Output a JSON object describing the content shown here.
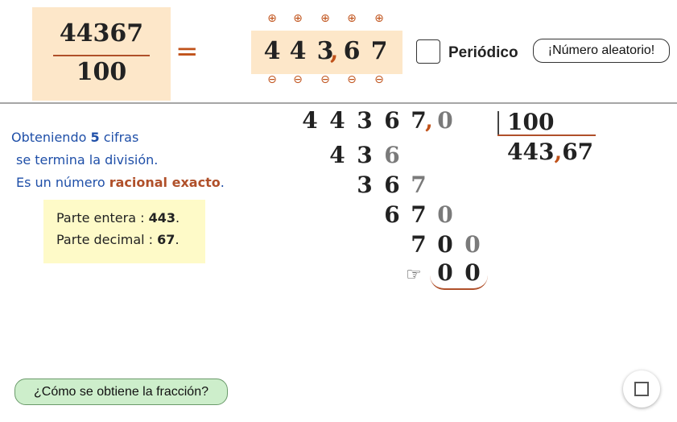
{
  "fraction": {
    "numerator": "44367",
    "denominator": "100"
  },
  "equals_sign": "=",
  "decimal": {
    "digits_int": [
      "4",
      "4",
      "3"
    ],
    "comma": ",",
    "digits_dec": [
      "6",
      "7"
    ],
    "plus_symbol": "⊕",
    "minus_symbol": "⊖"
  },
  "periodic": {
    "label": "Periódico",
    "checked": false
  },
  "random_button": {
    "label": "¡Número aleatorio!"
  },
  "info": {
    "line1_prefix": "Obteniendo ",
    "line1_count": "5",
    "line1_suffix": " cifras",
    "line2": "se termina la división.",
    "line3_prefix": "Es un número ",
    "line3_bold": "racional exacto",
    "line3_suffix": "."
  },
  "parts": {
    "integer_label": "Parte entera :",
    "integer_value": "443",
    "decimal_label": "Parte decimal :",
    "decimal_value": "67",
    "dot": "."
  },
  "division": {
    "dividend": [
      "4",
      "4",
      "3",
      "6",
      "7"
    ],
    "dividend_comma": ",",
    "dividend_extra": "0",
    "rows": [
      [
        "4",
        "3",
        "6"
      ],
      [
        "3",
        "6",
        "7"
      ],
      [
        "6",
        "7",
        "0"
      ],
      [
        "7",
        "0",
        "0"
      ],
      [
        "0",
        "0"
      ]
    ],
    "divisor": "100",
    "quotient_int": "443",
    "quotient_comma": ",",
    "quotient_dec": "67"
  },
  "how_button": {
    "label": "¿Cómo se obtiene la fracción?"
  },
  "icons": {
    "hand": "pointing-hand-icon",
    "fullscreen": "fullscreen-icon"
  },
  "colors": {
    "accent": "#c0521a",
    "info_blue": "#1f4fa8",
    "fraction_bg": "#fde7c9",
    "parts_bg": "#fefac8",
    "button_green": "#cdeecb"
  }
}
